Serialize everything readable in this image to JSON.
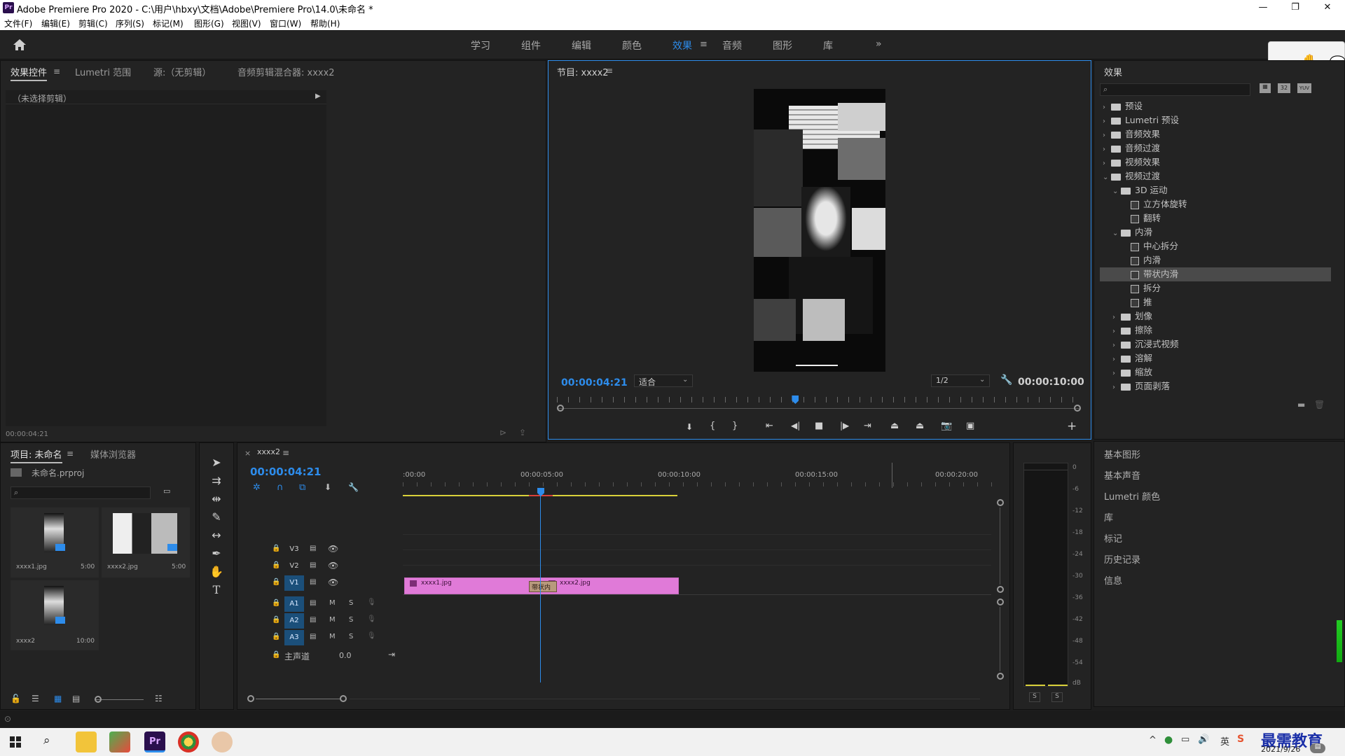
{
  "window": {
    "app_badge": "Pr",
    "title": "Adobe Premiere Pro 2020 - C:\\用户\\hbxy\\文档\\Adobe\\Premiere Pro\\14.0\\未命名 *",
    "minimize": "—",
    "maximize": "❐",
    "close": "✕"
  },
  "menu": [
    "文件(F)",
    "编辑(E)",
    "剪辑(C)",
    "序列(S)",
    "标记(M)",
    "图形(G)",
    "视图(V)",
    "窗口(W)",
    "帮助(H)"
  ],
  "workspaces": {
    "items": [
      "学习",
      "组件",
      "编辑",
      "颜色",
      "效果",
      "音频",
      "图形",
      "库"
    ],
    "active": "效果",
    "more": "»"
  },
  "effect_controls": {
    "tabs": [
      "效果控件",
      "Lumetri 范围",
      "源:（无剪辑）",
      "音频剪辑混合器: xxxx2"
    ],
    "no_clip": "（未选择剪辑）",
    "timecode": "00:00:04:21"
  },
  "program_monitor": {
    "title": "节目: xxxx2",
    "current_time": "00:00:04:21",
    "fit": "适合",
    "resolution": "1/2",
    "duration": "00:00:10:00",
    "playhead_fraction": 0.46
  },
  "effects_panel": {
    "title": "效果",
    "badges": [
      "32",
      "YUV"
    ],
    "tree": [
      {
        "label": "预设",
        "level": 0,
        "kind": "folder",
        "open": false
      },
      {
        "label": "Lumetri 预设",
        "level": 0,
        "kind": "folder",
        "open": false
      },
      {
        "label": "音频效果",
        "level": 0,
        "kind": "folder",
        "open": false
      },
      {
        "label": "音频过渡",
        "level": 0,
        "kind": "folder",
        "open": false
      },
      {
        "label": "视频效果",
        "level": 0,
        "kind": "folder",
        "open": false
      },
      {
        "label": "视频过渡",
        "level": 0,
        "kind": "folder",
        "open": true
      },
      {
        "label": "3D 运动",
        "level": 1,
        "kind": "folder",
        "open": true
      },
      {
        "label": "立方体旋转",
        "level": 2,
        "kind": "fx"
      },
      {
        "label": "翻转",
        "level": 2,
        "kind": "fx"
      },
      {
        "label": "内滑",
        "level": 1,
        "kind": "folder",
        "open": true
      },
      {
        "label": "中心拆分",
        "level": 2,
        "kind": "fx"
      },
      {
        "label": "内滑",
        "level": 2,
        "kind": "fx"
      },
      {
        "label": "带状内滑",
        "level": 2,
        "kind": "fx",
        "selected": true
      },
      {
        "label": "拆分",
        "level": 2,
        "kind": "fx"
      },
      {
        "label": "推",
        "level": 2,
        "kind": "fx"
      },
      {
        "label": "划像",
        "level": 1,
        "kind": "folder",
        "open": false
      },
      {
        "label": "擦除",
        "level": 1,
        "kind": "folder",
        "open": false
      },
      {
        "label": "沉浸式视频",
        "level": 1,
        "kind": "folder",
        "open": false
      },
      {
        "label": "溶解",
        "level": 1,
        "kind": "folder",
        "open": false
      },
      {
        "label": "缩放",
        "level": 1,
        "kind": "folder",
        "open": false
      },
      {
        "label": "页面剥落",
        "level": 1,
        "kind": "folder",
        "open": false
      }
    ]
  },
  "side_panels": [
    "基本图形",
    "基本声音",
    "Lumetri 颜色",
    "库",
    "标记",
    "历史记录",
    "信息"
  ],
  "project": {
    "tabs": [
      "项目: 未命名",
      "媒体浏览器"
    ],
    "file": "未命名.prproj",
    "items": [
      {
        "name": "xxxx1.jpg",
        "duration": "5:00"
      },
      {
        "name": "xxxx2.jpg",
        "duration": "5:00"
      },
      {
        "name": "xxxx2",
        "duration": "10:00"
      }
    ]
  },
  "timeline": {
    "tab": "xxxx2",
    "close": "×",
    "timecode": "00:00:04:21",
    "ruler": [
      ":00:00",
      "00:00:05:00",
      "00:00:10:00",
      "00:00:15:00",
      "00:00:20:00"
    ],
    "video_tracks": [
      "V3",
      "V2",
      "V1"
    ],
    "audio_tracks": [
      "A1",
      "A2",
      "A3"
    ],
    "master": "主声道",
    "master_value": "0.0",
    "clips": [
      {
        "name": "xxxx1.jpg",
        "track": "V1"
      },
      {
        "name": "xxxx2.jpg",
        "track": "V1"
      }
    ],
    "transition": "带状内"
  },
  "audio_meter": {
    "ticks": [
      "0",
      "-6",
      "-12",
      "-18",
      "-24",
      "-30",
      "-36",
      "-42",
      "-48",
      "-54",
      "dB"
    ],
    "solo": [
      "S",
      "S"
    ]
  },
  "taskbar": {
    "ime": "英",
    "watermark": "最需教育",
    "date": "2021/9/26"
  },
  "colors": {
    "accent": "#2d8ceb",
    "clip": "#e07ad8",
    "panel": "#232323",
    "work_area": "#d9d13a"
  }
}
